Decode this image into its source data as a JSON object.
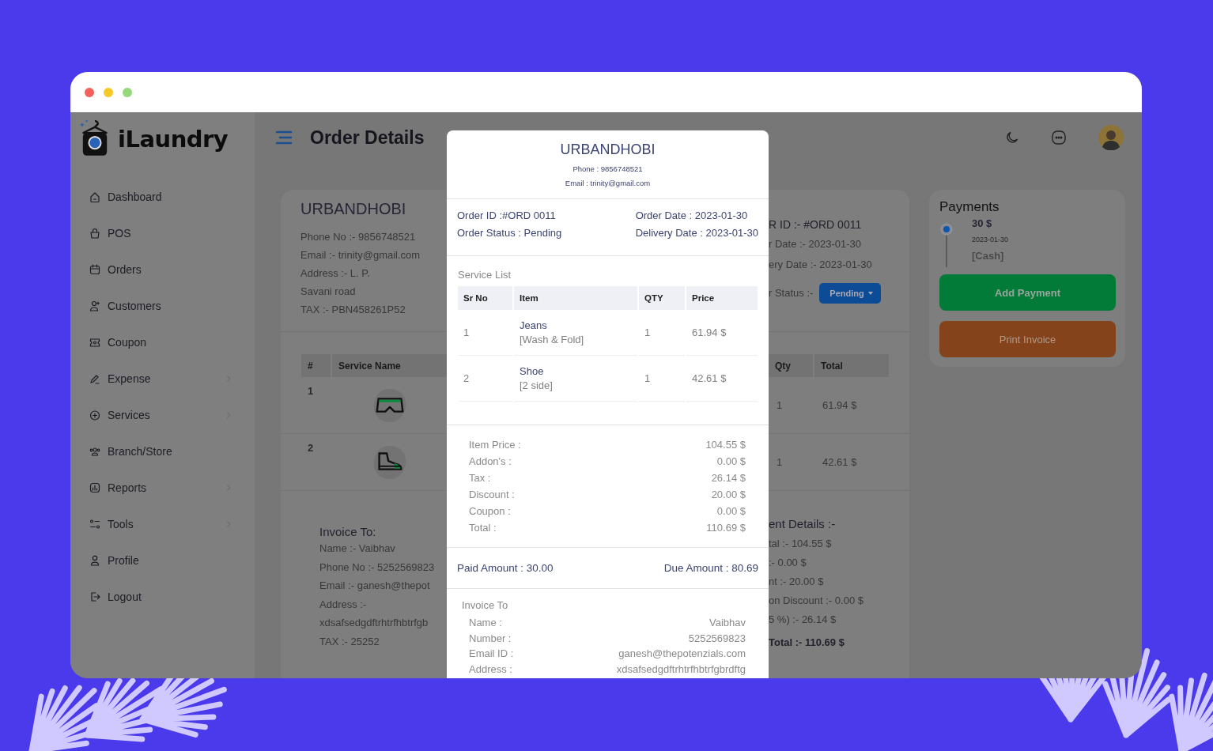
{
  "window": {
    "controls": [
      {
        "color": "#f4605a"
      },
      {
        "color": "#f6c927"
      },
      {
        "color": "#94d97a"
      }
    ]
  },
  "brand": {
    "name": "iLaundry"
  },
  "sidebar": {
    "items": [
      {
        "label": "Dashboard",
        "expandable": false
      },
      {
        "label": "POS",
        "expandable": false
      },
      {
        "label": "Orders",
        "expandable": false
      },
      {
        "label": "Customers",
        "expandable": false
      },
      {
        "label": "Coupon",
        "expandable": false
      },
      {
        "label": "Expense",
        "expandable": true
      },
      {
        "label": "Services",
        "expandable": true
      },
      {
        "label": "Branch/Store",
        "expandable": false
      },
      {
        "label": "Reports",
        "expandable": true
      },
      {
        "label": "Tools",
        "expandable": true
      },
      {
        "label": "Profile",
        "expandable": false
      },
      {
        "label": "Logout",
        "expandable": false
      }
    ]
  },
  "header": {
    "title": "Order Details"
  },
  "order_card": {
    "store": {
      "name": "URBANDHOBI",
      "lines": [
        "Phone No :- 9856748521",
        "Email :- trinity@gmail.com",
        "Address :- L. P.",
        "Savani road",
        "TAX :- PBN458261P52"
      ]
    },
    "order_info": {
      "id": "R ID :- #ORD 0011",
      "lines": [
        "r Date :- 2023-01-30",
        "ery Date :- 2023-01-30"
      ],
      "status_label": "r Status :-",
      "status": "Pending"
    },
    "table": {
      "columns": [
        "#",
        "Service Name",
        "Qty",
        "Total"
      ],
      "rows": [
        {
          "number": "1",
          "qty": "1",
          "total": "61.94 $"
        },
        {
          "number": "2",
          "qty": "1",
          "total": "42.61 $"
        }
      ]
    },
    "invoice_to": {
      "title": "Invoice To:",
      "lines": [
        "Name :- Vaibhav",
        "Phone No :- 5252569823",
        "Email :- ganesh@thepot",
        "Address :-",
        "xdsafsedgdftrhtrfhbtrfgb",
        "TAX :- 25252"
      ]
    },
    "payment_details": {
      "title": "ent Details :-",
      "lines": [
        "tal :- 104.55 $",
        ":- 0.00 $",
        "nt :- 20.00 $",
        "on Discount :- 0.00 $",
        "5 %) :- 26.14 $"
      ],
      "total": "Total :- 110.69 $"
    }
  },
  "payments": {
    "title": "Payments",
    "entries": [
      {
        "amount": "30 $",
        "date": "2023-01-30",
        "method": "[Cash]"
      }
    ],
    "buttons": [
      {
        "label": "Add Payment",
        "kind": "primary"
      },
      {
        "label": "Print Invoice",
        "kind": "print"
      }
    ]
  },
  "invoice_modal": {
    "store": "URBANDHOBI",
    "phone": "Phone : 9856748521",
    "email": "Email : trinity@gmail.com",
    "order_fields": {
      "left": [
        "Order ID :#ORD 0011",
        "Order Status : Pending"
      ],
      "right": [
        "Order Date : 2023-01-30",
        "Delivery Date : 2023-01-30"
      ]
    },
    "service_list": {
      "title": "Service List",
      "columns": [
        "Sr No",
        "Item",
        "QTY",
        "Price"
      ],
      "rows": [
        {
          "sr": "1",
          "item": "Jeans",
          "service": "[Wash & Fold]",
          "qty": "1",
          "price": "61.94 $"
        },
        {
          "sr": "2",
          "item": "Shoe",
          "service": "[2 side]",
          "qty": "1",
          "price": "42.61 $"
        }
      ]
    },
    "summary": [
      {
        "label": "Item Price :",
        "value": "104.55 $"
      },
      {
        "label": "Addon's :",
        "value": "0.00 $"
      },
      {
        "label": "Tax :",
        "value": "26.14 $"
      },
      {
        "label": "Discount :",
        "value": "20.00 $"
      },
      {
        "label": "Coupon :",
        "value": "0.00 $"
      },
      {
        "label": "Total :",
        "value": "110.69 $"
      }
    ],
    "paid": "Paid Amount : 30.00",
    "due": "Due Amount : 80.69",
    "invoice_to": {
      "title": "Invoice To",
      "fields": [
        {
          "label": "Name :",
          "value": "Vaibhav"
        },
        {
          "label": "Number :",
          "value": "5252569823"
        },
        {
          "label": "Email ID :",
          "value": "ganesh@thepotenzials.com"
        },
        {
          "label": "Address :",
          "value": "xdsafsedgdftrhtrfhbtrfgbrdftg"
        }
      ]
    }
  }
}
